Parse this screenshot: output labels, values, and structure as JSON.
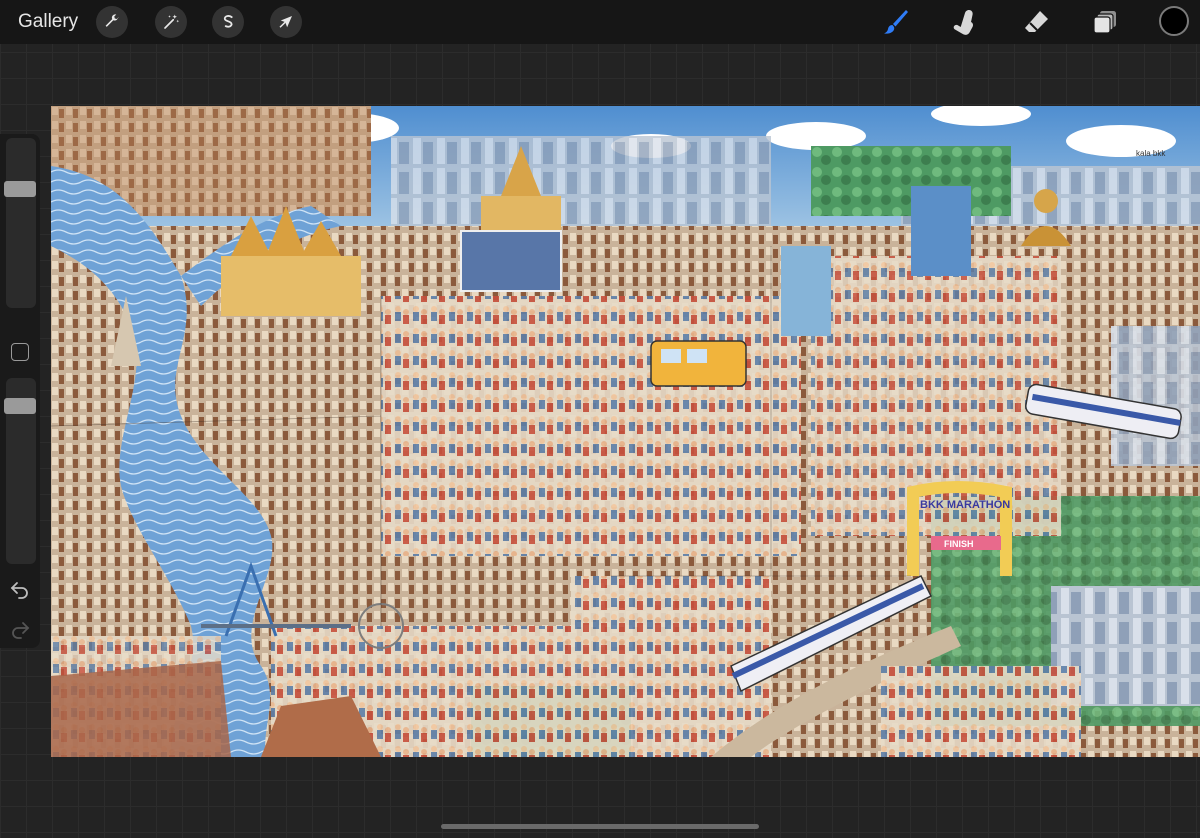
{
  "toolbar": {
    "gallery_label": "Gallery",
    "left_tools": [
      {
        "name": "actions",
        "icon": "wrench-icon"
      },
      {
        "name": "adjustments",
        "icon": "magic-wand-icon"
      },
      {
        "name": "selection",
        "icon": "selection-s-icon"
      },
      {
        "name": "transform",
        "icon": "arrow-cursor-icon"
      }
    ],
    "right_tools": [
      {
        "name": "brush",
        "icon": "brush-icon",
        "active": true,
        "color": "#2f7cf6"
      },
      {
        "name": "smudge",
        "icon": "smudge-finger-icon"
      },
      {
        "name": "eraser",
        "icon": "eraser-icon"
      },
      {
        "name": "layers",
        "icon": "layers-icon"
      }
    ],
    "current_color": "#000000"
  },
  "sidebar": {
    "brush_size_level": 0.72,
    "opacity_level": 0.12
  },
  "canvas": {
    "artwork": "bangkok-cityscape-illustration",
    "banner_text": "BKK MARATHON",
    "finish_text": "FINISH",
    "signature_text": "kala bkk"
  },
  "colors": {
    "toolbar_bg": "#161616",
    "app_bg": "#232323",
    "accent": "#2f7cf6"
  }
}
